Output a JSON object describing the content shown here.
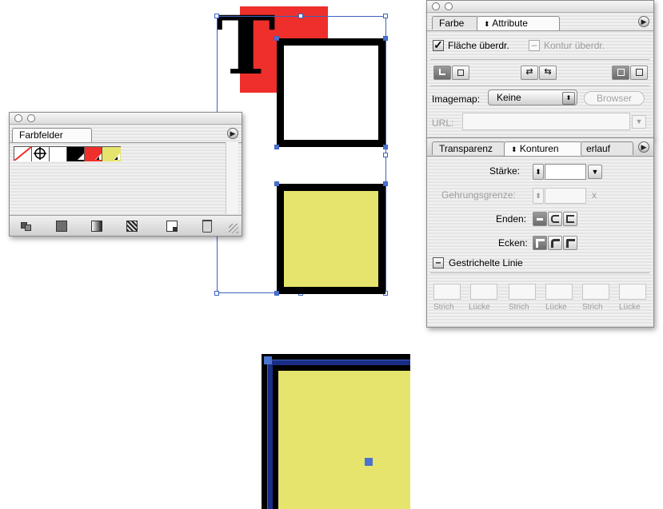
{
  "colors": {
    "red": "#ee2f2b",
    "yellow": "#e6e46c",
    "selection": "#3c63c0",
    "black": "#000000"
  },
  "canvas": {
    "type_glyph": "T"
  },
  "farbfelder_panel": {
    "tab_label": "Farbfelder",
    "menu_icon": "triangle-right-icon",
    "swatches": [
      {
        "name": "none-swatch",
        "color": "#ffffff"
      },
      {
        "name": "registration-swatch",
        "color": "#ffffff"
      },
      {
        "name": "paper-swatch",
        "color": "#ffffff"
      },
      {
        "name": "black-swatch",
        "color": "#000000"
      },
      {
        "name": "red-swatch",
        "color": "#ee2f2b"
      },
      {
        "name": "yellow-swatch",
        "color": "#e6e46c"
      }
    ],
    "footer_icons": [
      "show-all-swatches-icon",
      "show-color-swatches-icon",
      "show-gradient-swatches-icon",
      "show-pattern-swatches-icon",
      "new-swatch-icon",
      "trash-icon"
    ]
  },
  "attribute_panel": {
    "tabs": [
      "Farbe",
      "Attribute"
    ],
    "active_tab": "Attribute",
    "overprint_fill_label": "Fläche überdr.",
    "overprint_fill_checked": true,
    "overprint_stroke_label": "Kontur überdr.",
    "overprint_stroke_checked": false,
    "imagemap_label": "Imagemap:",
    "imagemap_value": "Keine",
    "browser_button": "Browser",
    "url_label": "URL:",
    "url_value": ""
  },
  "konturen_panel": {
    "tabs": [
      "Transparenz",
      "Konturen",
      "erlauf"
    ],
    "active_tab": "Konturen",
    "staerke_label": "Stärke:",
    "staerke_value": "",
    "gehrungsgrenze_label": "Gehrungsgrenze:",
    "gehrungsgrenze_value": "",
    "gehrungsgrenze_suffix": "x",
    "enden_label": "Enden:",
    "ecken_label": "Ecken:",
    "dashed_label": "Gestrichelte Linie",
    "dashed_checked": false,
    "dash_labels": [
      "Strich",
      "Lücke",
      "Strich",
      "Lücke",
      "Strich",
      "Lücke"
    ]
  }
}
